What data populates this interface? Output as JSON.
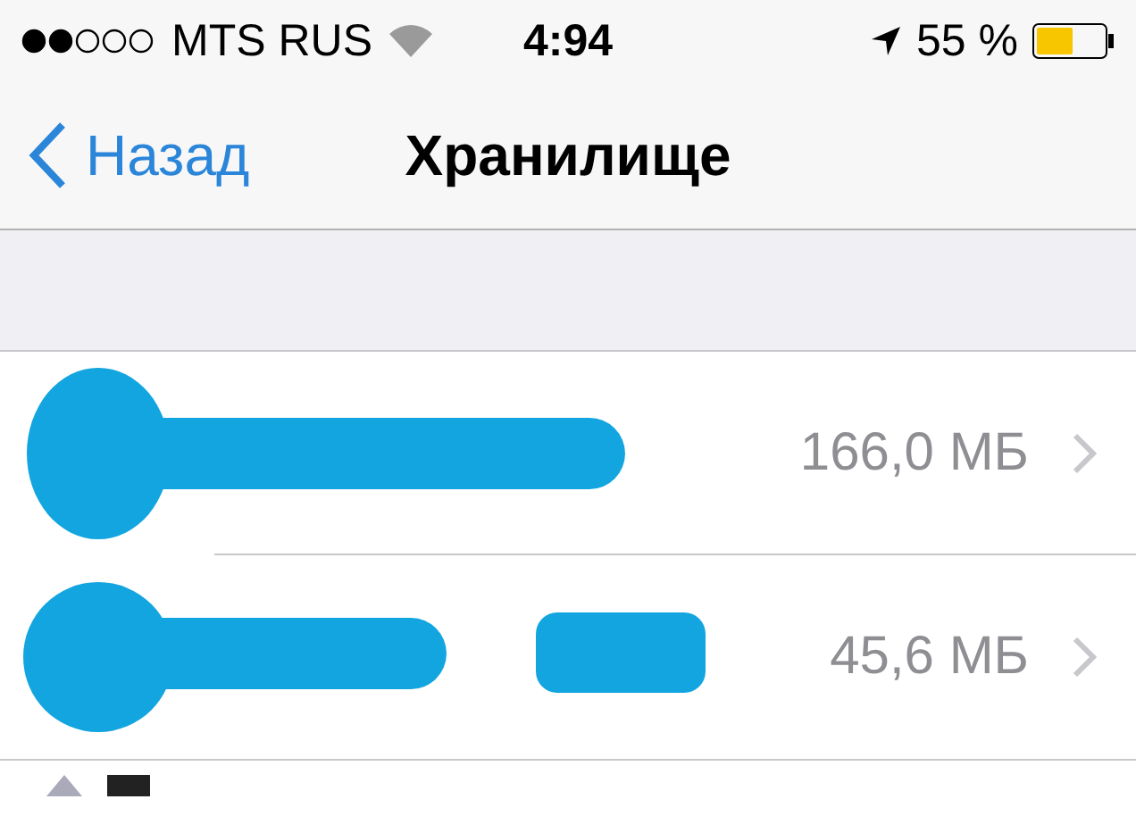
{
  "status_bar": {
    "carrier": "MTS RUS",
    "time": "4:94",
    "battery": "55 %"
  },
  "nav": {
    "back": "Назад",
    "title": "Хранилище"
  },
  "rows": [
    {
      "size": "166,0 МБ"
    },
    {
      "size": "45,6 МБ"
    }
  ]
}
